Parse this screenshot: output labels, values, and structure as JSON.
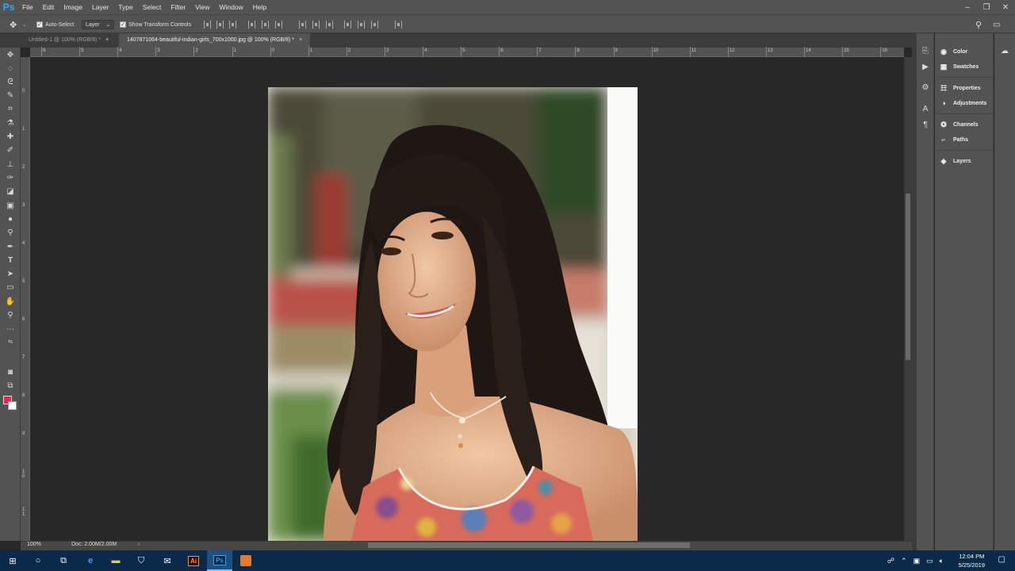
{
  "menubar": {
    "logo": "Ps",
    "items": [
      "File",
      "Edit",
      "Image",
      "Layer",
      "Type",
      "Select",
      "Filter",
      "View",
      "Window",
      "Help"
    ],
    "window_controls": [
      "–",
      "❐",
      "✕"
    ]
  },
  "options": {
    "auto_select_label": "Auto-Select",
    "auto_select_target": "Layer",
    "show_transform_label": "Show Transform Controls"
  },
  "tabs": [
    {
      "label": "Untitled-1 @ 100% (RGB/8) *",
      "active": false
    },
    {
      "label": "1407871064-beautiful-indian-girls_700x1000.jpg @ 100% (RGB/8) *",
      "active": true
    }
  ],
  "ruler": {
    "h_labels": [
      "6",
      "5",
      "4",
      "3",
      "2",
      "1",
      "0",
      "1",
      "2",
      "3",
      "4",
      "5",
      "6",
      "7",
      "8",
      "9",
      "10",
      "11",
      "12",
      "13",
      "14",
      "15",
      "16"
    ],
    "v_labels": [
      "0",
      "1",
      "2",
      "3",
      "4",
      "5",
      "6",
      "7",
      "8",
      "9",
      "1 0",
      "1 1"
    ]
  },
  "status": {
    "zoom": "100%",
    "doc": "Doc: 2.00M/2.00M"
  },
  "panels": [
    {
      "label": "Color",
      "icon": "color-wheel-icon"
    },
    {
      "label": "Swatches",
      "icon": "grid-icon"
    },
    {
      "label": "Properties",
      "icon": "sliders-icon"
    },
    {
      "label": "Adjustments",
      "icon": "half-circle-icon"
    },
    {
      "label": "Channels",
      "icon": "channels-icon"
    },
    {
      "label": "Paths",
      "icon": "paths-icon"
    },
    {
      "label": "Layers",
      "icon": "layers-icon"
    }
  ],
  "colors": {
    "foreground": "#e8225a",
    "background": "#ffffff"
  },
  "taskbar": {
    "time": "12:04 PM",
    "date": "5/25/2019",
    "apps": [
      "start",
      "search",
      "task-view",
      "edge",
      "explorer",
      "store",
      "mail",
      "illustrator",
      "photoshop",
      "other"
    ],
    "illustrator_label": "Ai",
    "photoshop_label": "Ps"
  }
}
